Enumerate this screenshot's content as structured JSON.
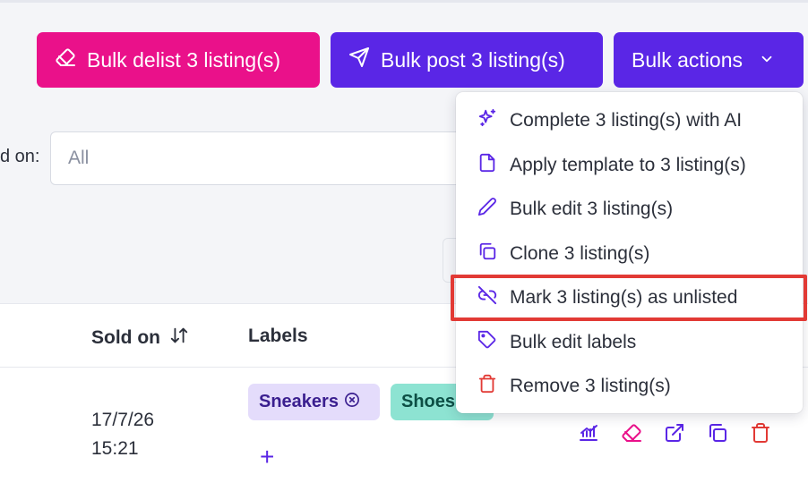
{
  "toolbar": {
    "delist_label": "Bulk delist 3 listing(s)",
    "post_label": "Bulk post 3 listing(s)",
    "actions_label": "Bulk actions"
  },
  "filter": {
    "label": "d on:",
    "value": "All"
  },
  "table": {
    "headers": {
      "sold_on": "Sold on",
      "labels": "Labels"
    },
    "row": {
      "date": "17/7/26",
      "time": "15:21",
      "tags": [
        "Sneakers",
        "Shoes"
      ],
      "add_label": "+"
    }
  },
  "menu": {
    "items": [
      {
        "label": "Complete 3 listing(s) with AI",
        "icon": "sparkles-icon"
      },
      {
        "label": "Apply template to 3 listing(s)",
        "icon": "file-icon"
      },
      {
        "label": "Bulk edit 3 listing(s)",
        "icon": "pencil-icon"
      },
      {
        "label": "Clone 3 listing(s)",
        "icon": "copy-icon"
      },
      {
        "label": "Mark 3 listing(s) as unlisted",
        "icon": "unlink-icon"
      },
      {
        "label": "Bulk edit labels",
        "icon": "tag-icon"
      },
      {
        "label": "Remove 3 listing(s)",
        "icon": "trash-icon"
      }
    ]
  },
  "colors": {
    "pink": "#ea118a",
    "purple": "#5a26e6",
    "danger": "#e23a35"
  }
}
